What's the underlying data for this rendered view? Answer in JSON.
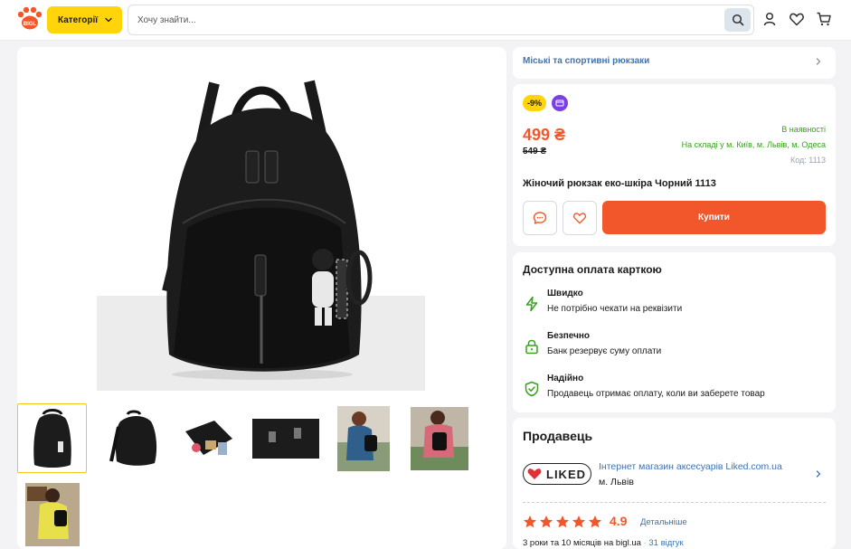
{
  "header": {
    "logo_text": "BIGL",
    "categories_label": "Категорії",
    "search_placeholder": "Хочу знайти...",
    "icons": [
      "search-icon",
      "user-icon",
      "heart-icon",
      "cart-icon"
    ]
  },
  "gallery": {
    "main_image": "black-backpack-photo",
    "thumbnails": [
      {
        "name": "backpack-front",
        "active": true
      },
      {
        "name": "backpack-side",
        "active": false
      },
      {
        "name": "backpack-open",
        "active": false
      },
      {
        "name": "backpack-detail",
        "active": false
      },
      {
        "name": "model-back-view",
        "active": false
      },
      {
        "name": "model-back-view-2",
        "active": false
      },
      {
        "name": "model-with-backpack",
        "active": false
      }
    ]
  },
  "breadcrumb": {
    "label": "Міські та спортивні рюкзаки"
  },
  "product": {
    "discount": "-9%",
    "price": "499 ₴",
    "old_price": "549 ₴",
    "availability": "В наявності",
    "warehouse": "На складі у м. Київ, м. Львів, м. Одеса",
    "code": "Код: 1113",
    "title": "Жіночий рюкзак еко-шкіра Чорний 1113",
    "buy_label": "Купити"
  },
  "payment": {
    "title": "Доступна оплата карткою",
    "features": [
      {
        "icon": "lightning-icon",
        "title": "Швидко",
        "desc": "Не потрібно чекати на реквізити"
      },
      {
        "icon": "lock-icon",
        "title": "Безпечно",
        "desc": "Банк резервує суму оплати"
      },
      {
        "icon": "shield-check-icon",
        "title": "Надійно",
        "desc": "Продавець отримає оплату, коли ви заберете товар"
      }
    ]
  },
  "seller": {
    "title": "Продавець",
    "logo_text": "LIKED",
    "name": "Інтернет магазин аксесуарів Liked.com.ua",
    "city": "м. Львів",
    "rating": "4.9",
    "stars": 5,
    "details_label": "Детальніше",
    "since": "3 роки та 10 місяців на bigl.ua",
    "separator": "·",
    "reviews": "31 відгук"
  },
  "colors": {
    "accent": "#f2572b",
    "yellow": "#ffd40b",
    "link": "#3d73b3",
    "green": "#3aa020"
  }
}
